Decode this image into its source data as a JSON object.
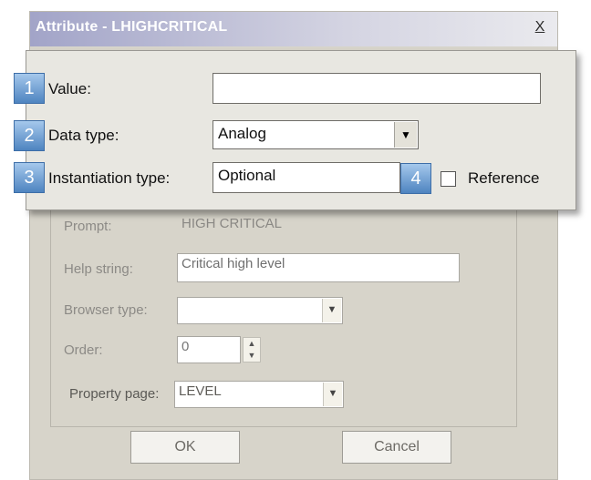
{
  "dialog": {
    "title": "Attribute - LHIGHCRITICAL",
    "close_label": "X"
  },
  "callouts": [
    "1",
    "2",
    "3",
    "4"
  ],
  "fields": {
    "value_label": "Value:",
    "value": "",
    "data_type_label": "Data type:",
    "data_type": "Analog",
    "instantiation_type_label": "Instantiation type:",
    "instantiation_type": "Optional",
    "reference_label": "Reference",
    "reference_checked": false,
    "prompt_label": "Prompt:",
    "prompt": "HIGH CRITICAL",
    "help_string_label": "Help string:",
    "help_string": "Critical high level",
    "browser_type_label": "Browser type:",
    "browser_type": "",
    "order_label": "Order:",
    "order": "0",
    "property_page_label": "Property page:",
    "property_page": "LEVEL"
  },
  "buttons": {
    "ok": "OK",
    "cancel": "Cancel"
  },
  "icons": {
    "dropdown": "chevron-down-icon",
    "spin_up": "caret-up-icon",
    "spin_down": "caret-down-icon",
    "close": "close-icon"
  },
  "colors": {
    "callout_badge": "#4e84c0",
    "dialog_face": "#d7d4ca",
    "title_gradient_start": "#a2a4c8"
  }
}
